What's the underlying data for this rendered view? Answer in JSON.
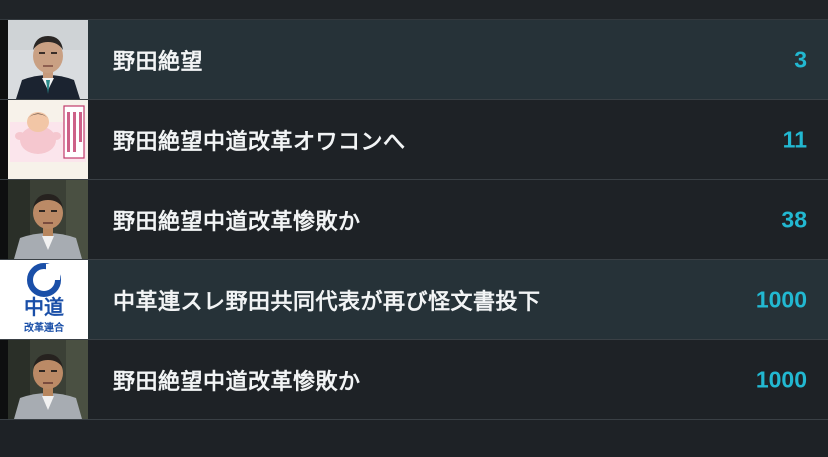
{
  "threads": [
    {
      "title": "野田絶望",
      "count": "3",
      "thumb_icon": "man-in-suit-portrait-icon",
      "highlighted": true
    },
    {
      "title": "野田絶望中道改革オワコンへ",
      "count": "11",
      "thumb_icon": "cartoon-illustration-icon",
      "highlighted": false
    },
    {
      "title": "野田絶望中道改革惨敗か",
      "count": "38",
      "thumb_icon": "man-in-suit-portrait-icon",
      "highlighted": false
    },
    {
      "title": "中革連スレ野田共同代表が再び怪文書投下",
      "count": "1000",
      "thumb_icon": "party-logo-icon",
      "logo_text": "中道",
      "logo_subtext": "改革連合",
      "highlighted": true
    },
    {
      "title": "野田絶望中道改革惨敗か",
      "count": "1000",
      "thumb_icon": "man-in-suit-portrait-icon",
      "highlighted": false
    }
  ],
  "colors": {
    "background": "#1e2226",
    "highlight_row": "#263238",
    "count_accent": "#22b8d1",
    "title_text": "#f2f4f5"
  }
}
